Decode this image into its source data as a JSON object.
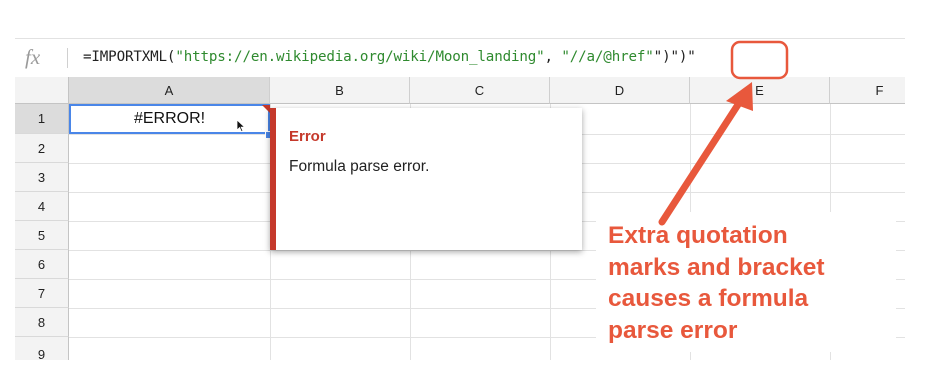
{
  "formula_bar": {
    "fx_label": "fx",
    "formula_prefix": "=IMPORTXML(",
    "url_string": "\"https://en.wikipedia.org/wiki/Moon_landing\"",
    "separator": ", ",
    "xpath_string": "\"//a/@href\"",
    "extra_quote": "\"",
    "extra_chars_rest": ")\")\""
  },
  "columns": [
    "A",
    "B",
    "C",
    "D",
    "E",
    "F"
  ],
  "rows": [
    "1",
    "2",
    "3",
    "4",
    "5",
    "6",
    "7",
    "8",
    "9"
  ],
  "active_cell": {
    "ref": "A1",
    "value": "#ERROR!"
  },
  "error_popup": {
    "title": "Error",
    "message": "Formula parse error."
  },
  "annotation": {
    "lines": [
      "Extra quotation",
      "marks and bracket",
      "causes a formula",
      "parse error"
    ],
    "color": "#e8583c"
  },
  "colors": {
    "error_red": "#c5392b",
    "selection_blue": "#4a86e8",
    "string_green": "#2f8a2f"
  }
}
